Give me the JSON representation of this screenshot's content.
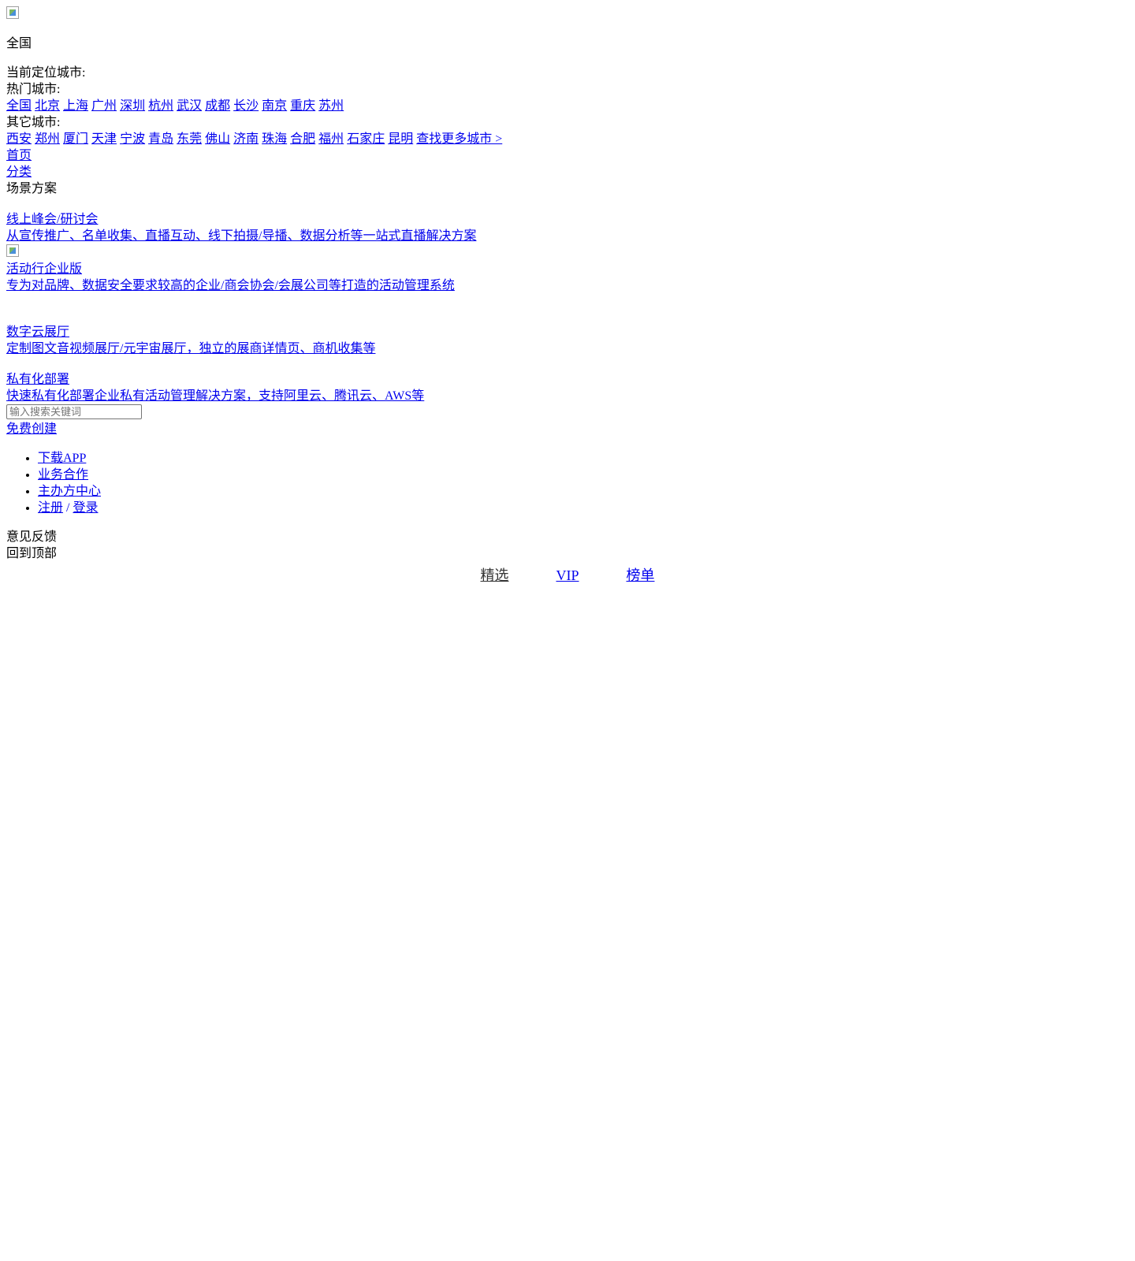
{
  "header": {
    "logo_alt": "",
    "current_city": "全国",
    "locate_label": "当前定位城市:",
    "hot_label": "热门城市:",
    "hot_cities": [
      "全国",
      "北京",
      "上海",
      "广州",
      "深圳",
      "杭州",
      "武汉",
      "成都",
      "长沙",
      "南京",
      "重庆",
      "苏州"
    ],
    "other_label": "其它城市:",
    "other_cities": [
      "西安",
      "郑州",
      "厦门",
      "天津",
      "宁波",
      "青岛",
      "东莞",
      "佛山",
      "济南",
      "珠海",
      "合肥",
      "福州",
      "石家庄",
      "昆明"
    ],
    "more_cities": "查找更多城市 >"
  },
  "nav": {
    "home": "首页",
    "category": "分类",
    "scenario": "场景方案"
  },
  "solutions": [
    {
      "title": "线上峰会/研讨会",
      "desc": "从宣传推广、名单收集、直播互动、线下拍摄/导播、数据分析等一站式直播解决方案"
    },
    {
      "title": "活动行企业版",
      "desc": "专为对品牌、数据安全要求较高的企业/商会协会/会展公司等打造的活动管理系统"
    },
    {
      "title": "数字云展厅",
      "desc": "定制图文音视频展厅/元宇宙展厅，独立的展商详情页、商机收集等"
    },
    {
      "title": "私有化部署",
      "desc": "快速私有化部署企业私有活动管理解决方案，支持阿里云、腾讯云、AWS等"
    }
  ],
  "search": {
    "placeholder": "输入搜索关键词"
  },
  "create": "免费创建",
  "menu": {
    "download_app": "下载APP",
    "business": "业务合作",
    "organizer": "主办方中心",
    "register": "注册",
    "separator": "/",
    "login": "登录"
  },
  "feedback": "意见反馈",
  "back_to_top": "回到顶部",
  "tabs": [
    "精选",
    "VIP",
    "榜单"
  ]
}
